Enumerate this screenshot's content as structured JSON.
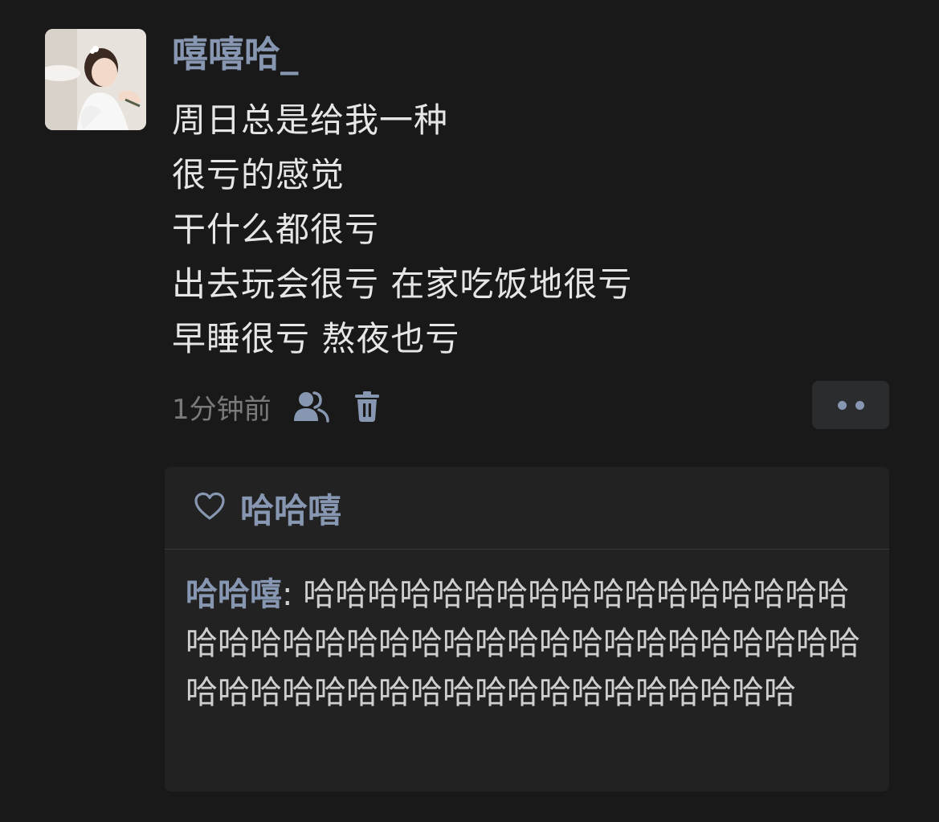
{
  "post": {
    "username": "嘻嘻哈_",
    "lines": [
      "周日总是给我一种",
      "很亏的感觉",
      "干什么都很亏",
      "出去玩会很亏 在家吃饭地很亏",
      "早睡很亏 熬夜也亏"
    ],
    "time": "1分钟前",
    "icons": {
      "visibility": "friends-icon",
      "delete": "trash-icon",
      "more": "more-dots-icon",
      "like": "heart-icon"
    }
  },
  "likes": {
    "users": [
      "哈哈嘻"
    ]
  },
  "comments": [
    {
      "user": "哈哈嘻",
      "separator": ": ",
      "text": "哈哈哈哈哈哈哈哈哈哈哈哈哈哈哈哈哈哈哈哈哈哈哈哈哈哈哈哈哈哈哈哈哈哈哈哈哈哈哈哈哈哈哈哈哈哈哈哈哈哈哈哈哈哈哈哈哈"
    }
  ],
  "colors": {
    "background": "#191919",
    "accent_name": "#8797b1",
    "body_text": "#e6e6e6",
    "muted_text": "#7a7a7a",
    "panel": "#222222"
  }
}
